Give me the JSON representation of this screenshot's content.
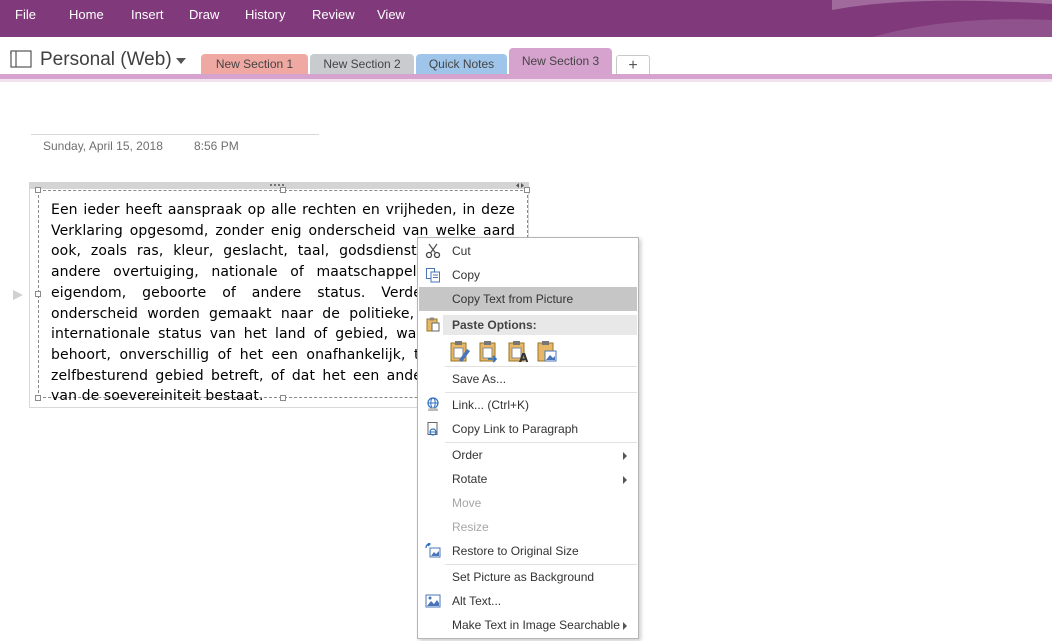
{
  "ribbon": {
    "menu": [
      "File",
      "Home",
      "Insert",
      "Draw",
      "History",
      "Review",
      "View"
    ]
  },
  "notebook": {
    "title": "Personal (Web)",
    "tabs": [
      {
        "label": "New Section 1",
        "color": "#f0a9a2"
      },
      {
        "label": "New Section 2",
        "color": "#c9cccf"
      },
      {
        "label": "Quick Notes",
        "color": "#9fc6ea"
      },
      {
        "label": "New Section 3",
        "color": "#d6a3cf"
      }
    ],
    "add_tab": "+"
  },
  "page": {
    "date": "Sunday, April 15, 2018",
    "time": "8:56 PM",
    "picture_text": "Een ieder heeft aanspraak op alle rechten en vrijheden, in deze Verklaring opgesomd, zonder enig onderscheid van welke aard ook, zoals ras, kleur, geslacht, taal, godsdienst, politieke of andere overtuiging, nationale of maatschappelijke afkomst, eigendom, geboorte of andere status. Verder zal geen onderscheid worden gemaakt naar de politieke, juridische of internationale status van het land of gebied, waartoe iemand behoort, onverschillig of het een onafhankelijk, trust, of niet-zelfbesturend gebied betreft, of dat het een andere beperking van de soevereiniteit bestaat."
  },
  "context_menu": {
    "cut": "Cut",
    "copy": "Copy",
    "copy_text_from_picture": "Copy Text from Picture",
    "paste_options": "Paste Options:",
    "save_as": "Save As...",
    "link": "Link...  (Ctrl+K)",
    "copy_link_to_paragraph": "Copy Link to Paragraph",
    "order": "Order",
    "rotate": "Rotate",
    "move": "Move",
    "resize": "Resize",
    "restore_original_size": "Restore to Original Size",
    "set_picture_background": "Set Picture as Background",
    "alt_text": "Alt Text...",
    "make_text_searchable": "Make Text in Image Searchable"
  },
  "colors": {
    "ribbon": "#80397b",
    "accent_section": "#d6a3cf",
    "highlight": "#c6c6c6"
  }
}
